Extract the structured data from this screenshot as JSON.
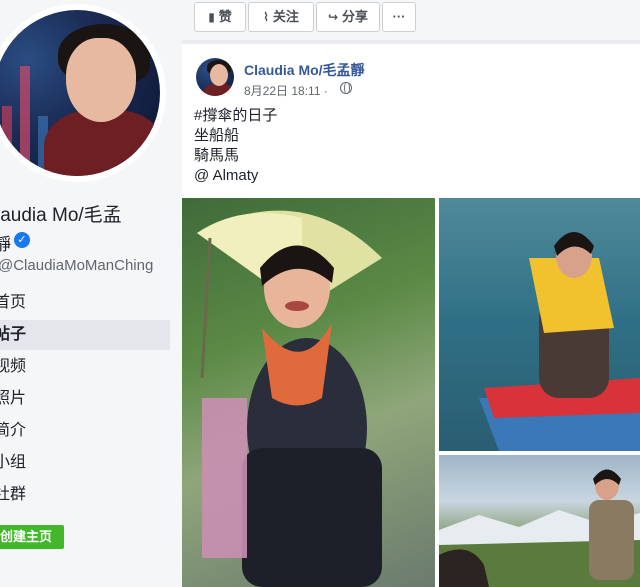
{
  "sidebar": {
    "page_name_line1": "laudia Mo/毛孟",
    "page_name_line2": "靜",
    "username": "@ClaudiaMoManChing",
    "nav_items": [
      {
        "label": "首页"
      },
      {
        "label": "帖子",
        "active": true
      },
      {
        "label": "视频"
      },
      {
        "label": "照片"
      },
      {
        "label": "简介"
      },
      {
        "label": "小组"
      },
      {
        "label": "社群"
      }
    ],
    "create_page_label": "创建主页"
  },
  "action_bar": {
    "like_label": "赞",
    "follow_label": "关注",
    "share_label": "分享",
    "more_label": "···",
    "like_icon": "thumbs-up-icon",
    "follow_icon": "rss-icon",
    "share_icon": "share-arrow-icon"
  },
  "post": {
    "author": "Claudia Mo/毛孟靜",
    "timestamp": "8月22日 18:11 ·",
    "privacy_icon": "globe-icon",
    "lines": [
      "#撐傘的日子",
      "坐船船",
      "騎馬馬",
      "@ Almaty"
    ]
  },
  "colors": {
    "link": "#365899",
    "verified": "#1877f2",
    "create_button": "#42b72a"
  }
}
